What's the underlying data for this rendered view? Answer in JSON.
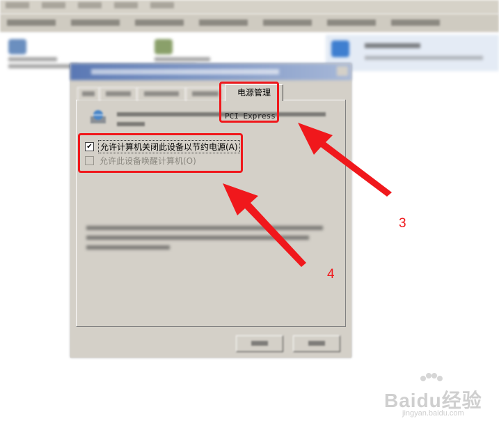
{
  "dialog": {
    "active_tab": "电源管理",
    "device_name_visible": "PCI Express",
    "checkbox_allow_power_off": {
      "label": "允许计算机关闭此设备以节约电源(A)",
      "checked": true
    },
    "checkbox_allow_wake": {
      "label": "允许此设备唤醒计算机(O)",
      "checked": false,
      "disabled": true
    },
    "checked_glyph": "✔"
  },
  "annotations": {
    "step3_label": "3",
    "step4_label": "4",
    "highlight_color": "#f0181c"
  },
  "watermark": {
    "brand": "Baidu经验",
    "site": "jingyan.baidu.com"
  }
}
